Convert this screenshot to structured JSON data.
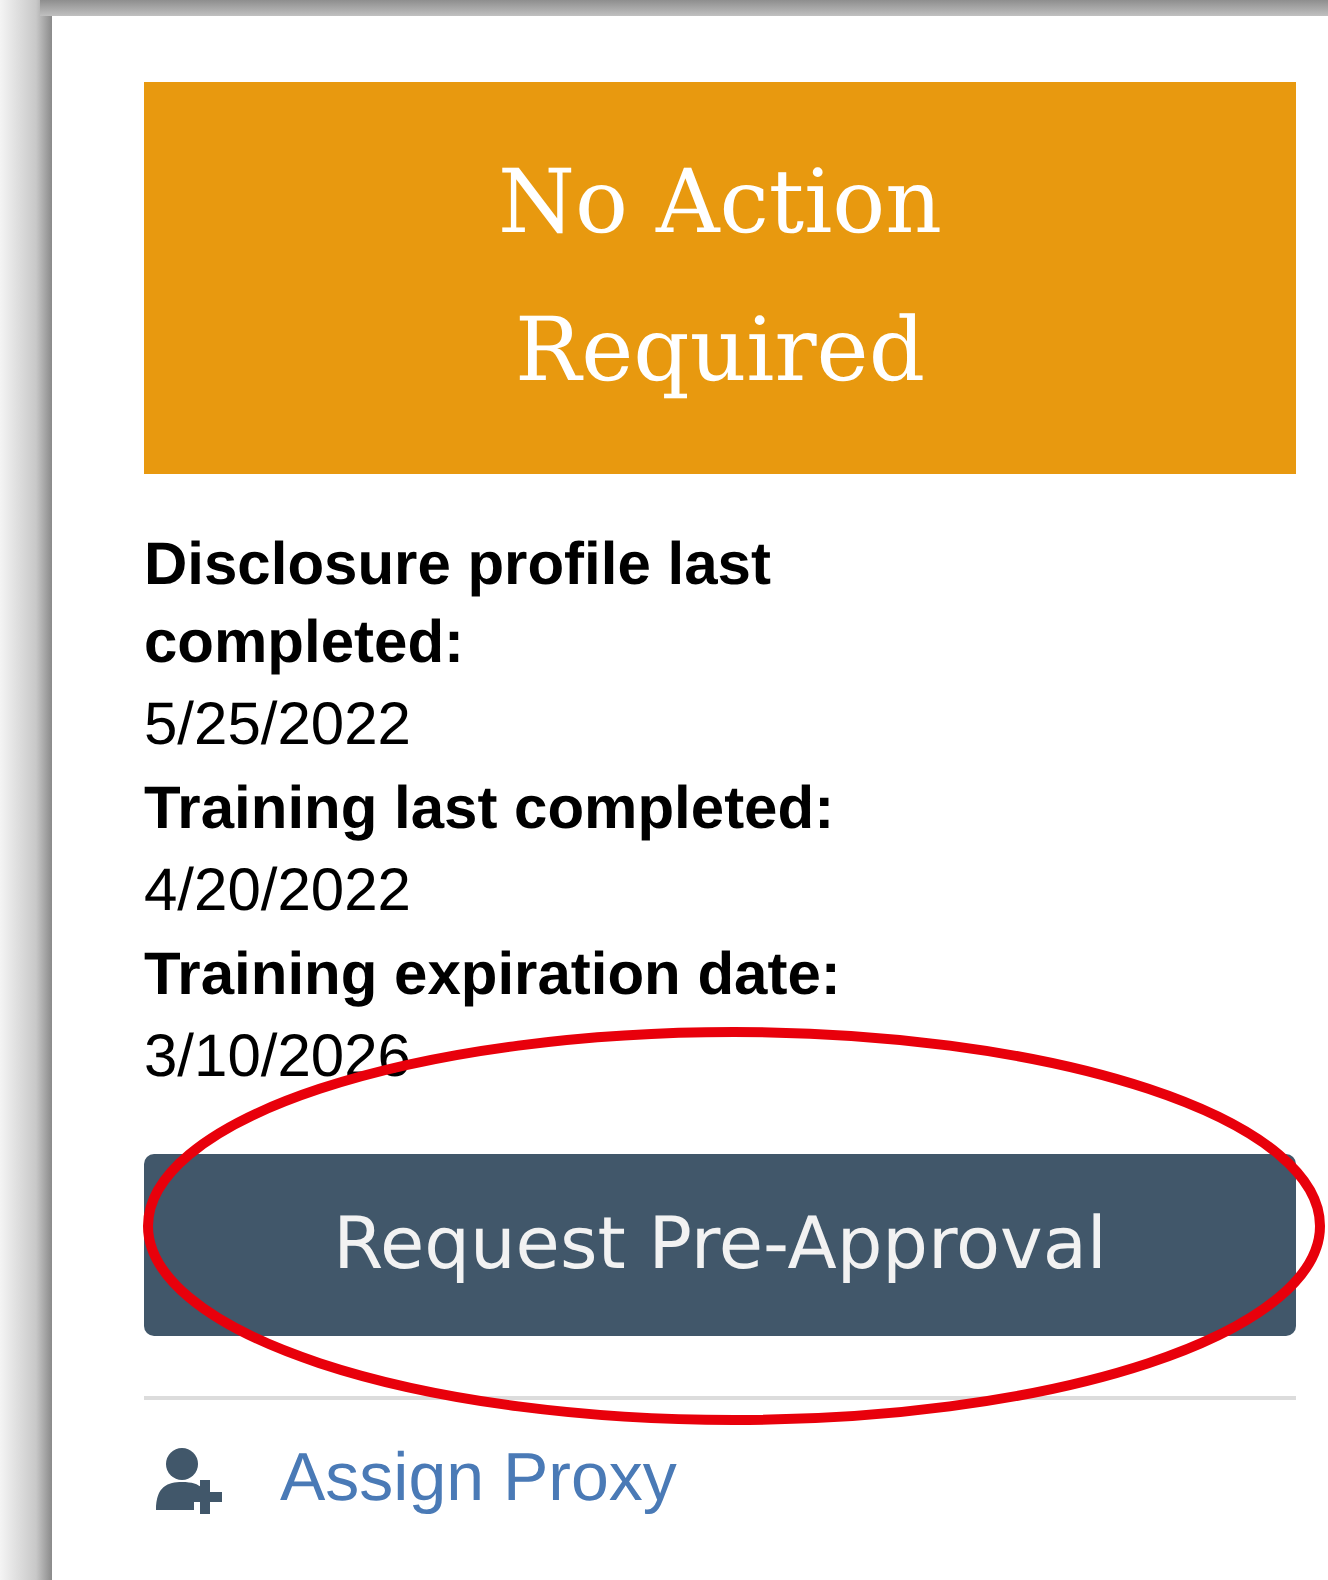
{
  "status_banner": {
    "text": "No Action Required"
  },
  "fields": [
    {
      "label": "Disclosure profile last completed:",
      "value": "5/25/2022"
    },
    {
      "label": "Training last completed:",
      "value": "4/20/2022"
    },
    {
      "label": "Training expiration date:",
      "value": "3/10/2026"
    }
  ],
  "primary_button": {
    "label": "Request Pre-Approval"
  },
  "links": [
    {
      "label": "Assign Proxy"
    }
  ]
}
